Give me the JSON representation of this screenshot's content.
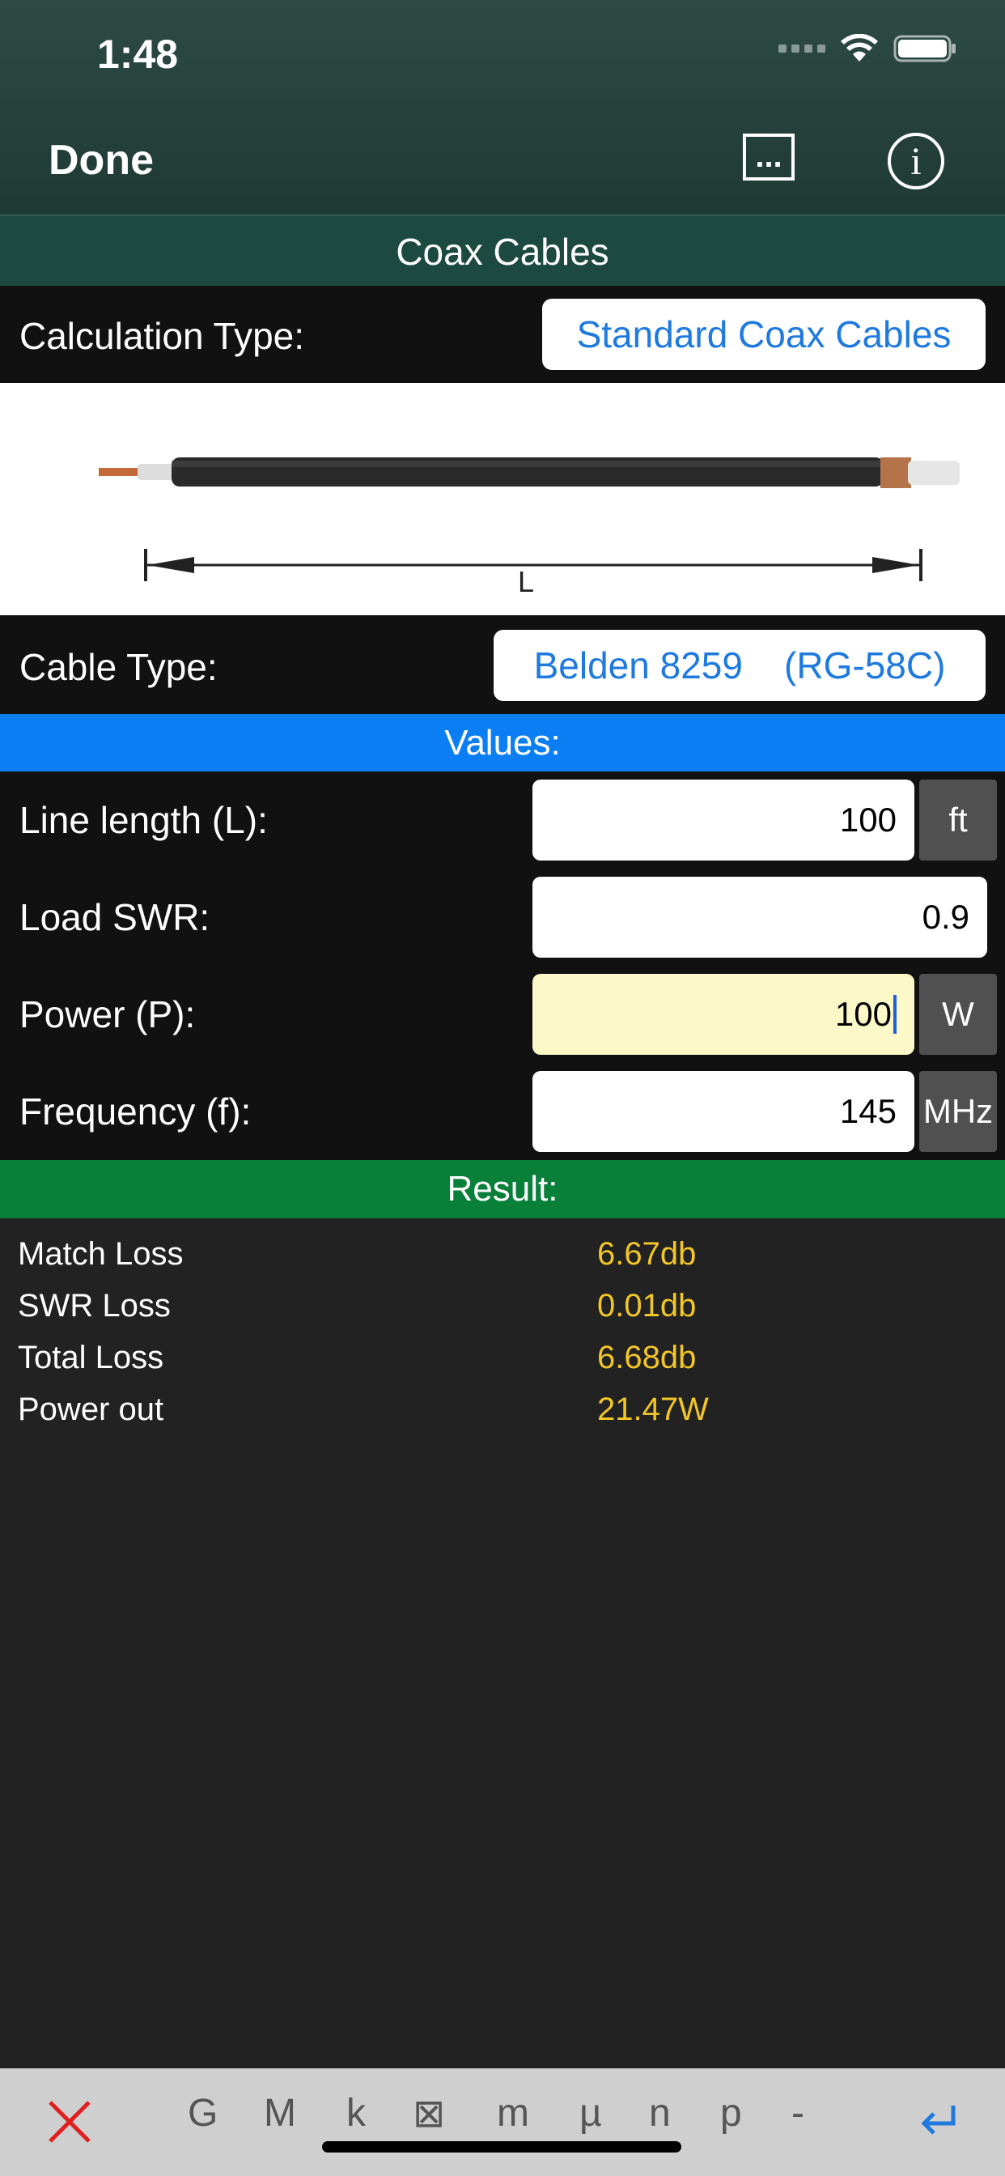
{
  "status_bar": {
    "time": "1:48"
  },
  "nav": {
    "done_label": "Done",
    "more_label": "...",
    "info_label": "i"
  },
  "title": "Coax Cables",
  "calculation": {
    "label": "Calculation Type:",
    "value": "Standard Coax Cables"
  },
  "cable_image": {
    "length_label": "L"
  },
  "cable": {
    "label": "Cable Type:",
    "value": "Belden 8259    (RG-58C)"
  },
  "values": {
    "header": "Values:",
    "line_length": {
      "label": "Line length (L):",
      "value": "100",
      "unit": "ft"
    },
    "load_swr": {
      "label": "Load SWR:",
      "value": "0.9"
    },
    "power": {
      "label": "Power (P):",
      "value": "100",
      "unit": "W"
    },
    "frequency": {
      "label": "Frequency (f):",
      "value": "145",
      "unit": "MHz"
    }
  },
  "result": {
    "header": "Result:",
    "rows": [
      {
        "label": "Match Loss",
        "value": "6.67db"
      },
      {
        "label": "SWR Loss",
        "value": "0.01db"
      },
      {
        "label": "Total Loss",
        "value": "6.68db"
      },
      {
        "label": "Power out",
        "value": "21.47W"
      }
    ]
  },
  "keyboard": {
    "keys": [
      "G",
      "M",
      "k",
      "⊠",
      "m",
      "µ",
      "n",
      "p",
      "-"
    ],
    "close_icon": "close-icon",
    "return_icon": "return-icon"
  },
  "colors": {
    "accent_blue": "#1f7ae0",
    "values_header": "#0a7ef2",
    "result_header": "#08803a",
    "result_value": "#f2c627",
    "active_field": "#fdf8c8"
  }
}
